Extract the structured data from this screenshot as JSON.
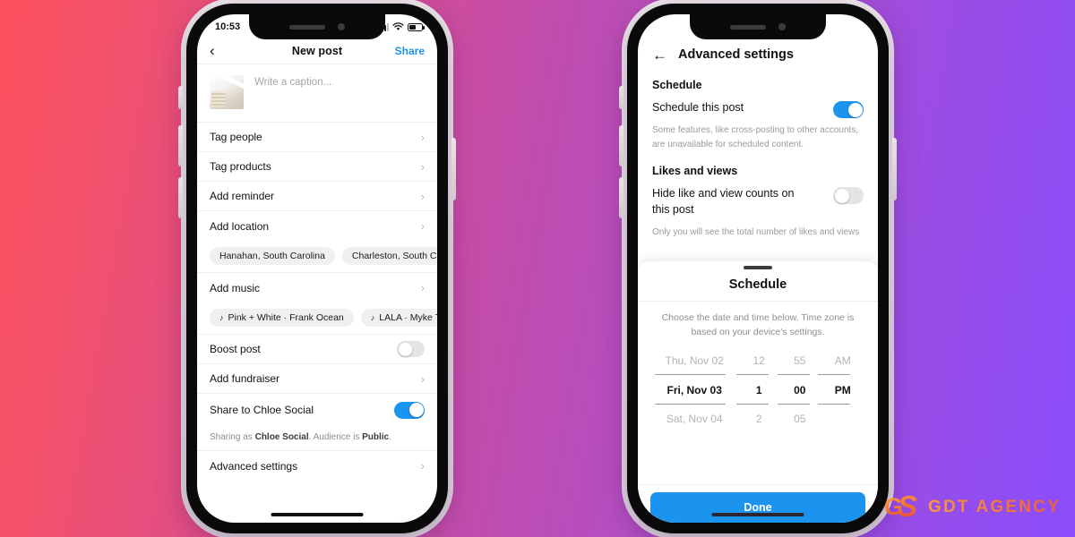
{
  "background": {
    "from": "#fb4f5b",
    "mid": "#c04dae",
    "to": "#8a4dfb"
  },
  "accent": {
    "blue": "#1b94ef",
    "toggle_off": "#e4e4e4"
  },
  "left_phone": {
    "status_bar": {
      "time": "10:53",
      "signal_icon": "signal-bars-icon",
      "wifi_icon": "wifi-icon",
      "battery_icon": "battery-icon"
    },
    "nav": {
      "back_icon": "chevron-left-icon",
      "title": "New post",
      "action": "Share"
    },
    "caption": {
      "placeholder": "Write a caption...",
      "thumbnail": "post-thumbnail-image"
    },
    "rows": [
      {
        "label": "Tag people",
        "type": "chevron"
      },
      {
        "label": "Tag products",
        "type": "chevron"
      },
      {
        "label": "Add reminder",
        "type": "chevron"
      },
      {
        "label": "Add location",
        "type": "chevron"
      }
    ],
    "location_chips": [
      {
        "label": "Hanahan, South Carolina"
      },
      {
        "label": "Charleston, South Carolina"
      }
    ],
    "music_row": {
      "label": "Add music",
      "type": "chevron"
    },
    "music_chips": [
      {
        "icon": "music-note-icon",
        "label": "Pink + White · Frank Ocean"
      },
      {
        "icon": "music-note-icon",
        "label": "LALA · Myke Towers"
      }
    ],
    "boost": {
      "label": "Boost post",
      "toggle": "off"
    },
    "fundraiser": {
      "label": "Add fundraiser",
      "type": "chevron"
    },
    "share_to": {
      "label": "Share to Chloe Social",
      "toggle": "on"
    },
    "sharing_note": {
      "prefix": "Sharing as ",
      "account": "Chloe Social",
      "middle": ". Audience is ",
      "audience": "Public",
      "suffix": "."
    },
    "advanced": {
      "label": "Advanced settings",
      "type": "chevron"
    }
  },
  "right_phone": {
    "nav": {
      "back_icon": "arrow-left-icon",
      "title": "Advanced settings"
    },
    "schedule_section": {
      "heading": "Schedule",
      "row_label": "Schedule this post",
      "toggle": "on",
      "help": "Some features, like cross-posting to other accounts, are unavailable for scheduled content."
    },
    "likes_section": {
      "heading": "Likes and views",
      "row_label": "Hide like and view counts on this post",
      "toggle": "off",
      "help": "Only you will see the total number of likes and views"
    },
    "sheet": {
      "grabber": "drag-handle",
      "title": "Schedule",
      "note": "Choose the date and time below. Time zone is based on your device's settings.",
      "picker": {
        "rows": [
          {
            "date": "Thu, Nov 02",
            "hour": "12",
            "minute": "55",
            "ampm": "AM",
            "selected": false
          },
          {
            "date": "Fri, Nov 03",
            "hour": "1",
            "minute": "00",
            "ampm": "PM",
            "selected": true
          },
          {
            "date": "Sat, Nov 04",
            "hour": "2",
            "minute": "05",
            "ampm": "",
            "selected": false
          }
        ]
      },
      "done_label": "Done"
    }
  },
  "watermark": {
    "mark_g": "G",
    "mark_s": "S",
    "text": "GDT AGENCY"
  }
}
